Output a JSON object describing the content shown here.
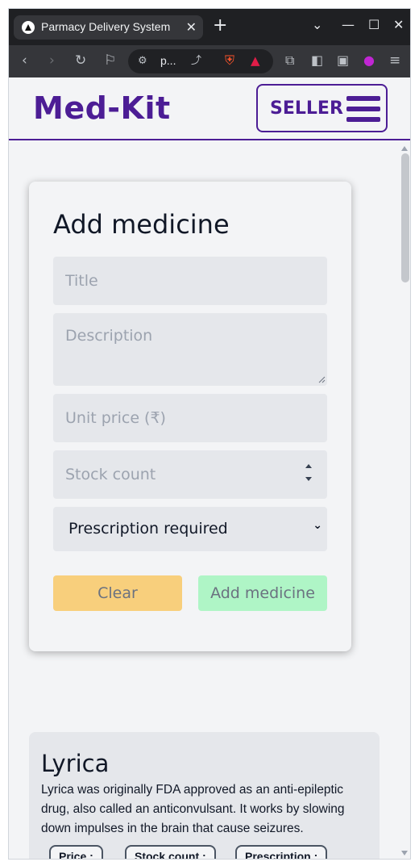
{
  "browser": {
    "tab_title": "Parmacy Delivery System",
    "url_display": "p..."
  },
  "header": {
    "brand": "Med-Kit",
    "seller_label": "SELLER"
  },
  "form": {
    "title": "Add medicine",
    "title_placeholder": "Title",
    "description_placeholder": "Description",
    "price_placeholder": "Unit price (₹)",
    "stock_placeholder": "Stock count",
    "prescription_value": "Prescription required",
    "clear_label": "Clear",
    "add_label": "Add medicine"
  },
  "product": {
    "name": "Lyrica",
    "description": "Lyrica was originally FDA approved as an anti-epileptic drug, also called an anticonvulsant. It works by slowing down impulses in the brain that cause seizures.",
    "chips": [
      "Price :",
      "Stock count :",
      "Prescription :"
    ]
  },
  "colors": {
    "brand": "#4c1d95",
    "clear_button": "#f8cf7c",
    "add_button": "#aff5c6"
  },
  "icons": {
    "menu": "hamburger-icon",
    "tab_close": "close-icon",
    "new_tab": "plus-icon",
    "back": "back-arrow-icon",
    "forward": "forward-arrow-icon",
    "reload": "reload-icon",
    "bookmark": "bookmark-icon"
  }
}
